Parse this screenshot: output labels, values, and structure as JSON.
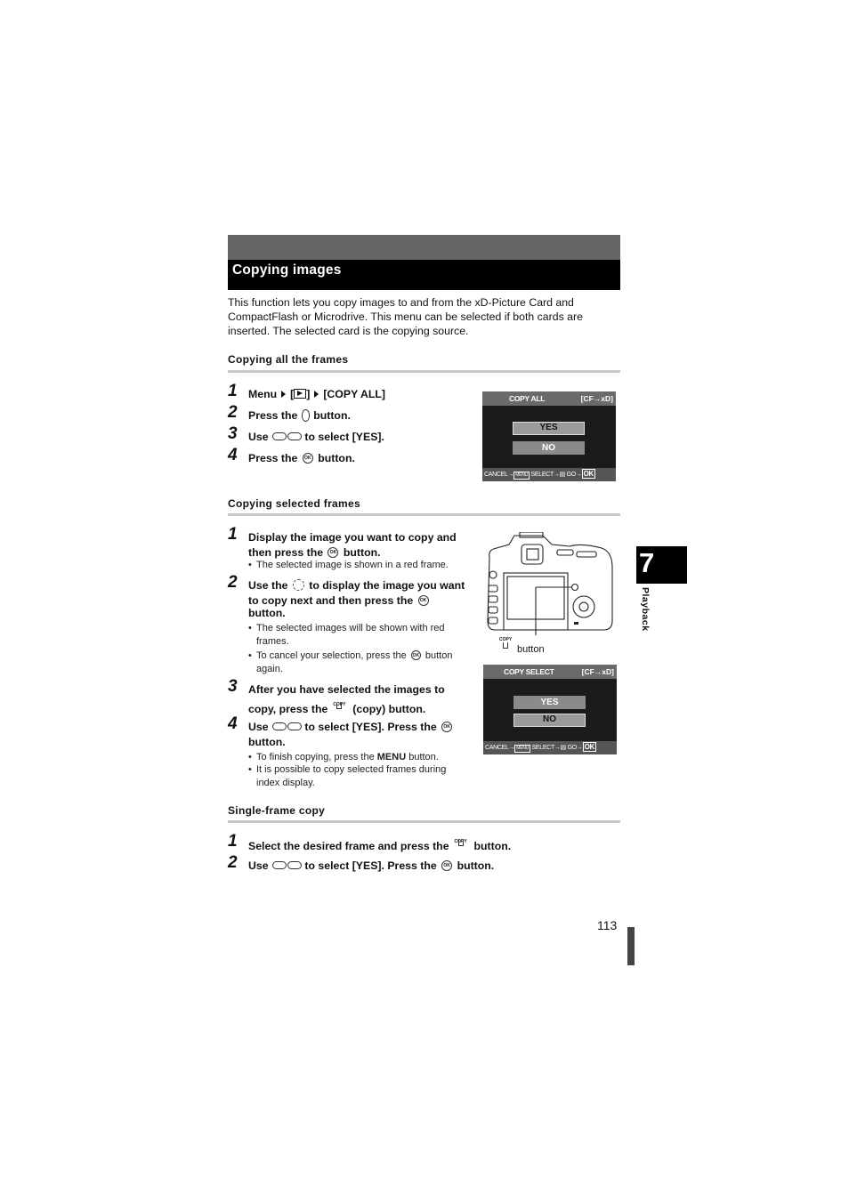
{
  "section_title": "Copying images",
  "intro": "This function lets you copy images to and from the xD-Picture Card and CompactFlash or Microdrive. This menu can be selected if both cards are inserted. The selected card is the copying source.",
  "copy_all": {
    "heading": "Copying all the frames",
    "steps": [
      {
        "num": "1",
        "parts": [
          "Menu",
          "[",
          "]",
          "[COPY ALL]"
        ]
      },
      {
        "num": "2",
        "before": "Press the",
        "after": "button."
      },
      {
        "num": "3",
        "before": "Use",
        "after": "to select [YES]."
      },
      {
        "num": "4",
        "before": "Press the",
        "after": "button."
      }
    ],
    "screen": {
      "title": "COPY ALL",
      "card": "[CF→xD]",
      "options": [
        "YES",
        "NO"
      ],
      "selected": "YES",
      "footer": {
        "cancel": "CANCEL→",
        "menu": "MENU",
        "select": "SELECT→",
        "go": "GO→",
        "ok": "OK"
      }
    }
  },
  "copy_selected": {
    "heading": "Copying selected frames",
    "steps": [
      {
        "num": "1",
        "line1": "Display the image you want to copy and",
        "before": "then press the",
        "after": "button.",
        "bullets": [
          "The selected image is shown in a red frame."
        ]
      },
      {
        "num": "2",
        "before": "Use the",
        "mid": "to display the image you want",
        "line2": "to copy next and then press the",
        "line3": "button.",
        "bullets": [
          "The selected images will be shown with red frames.",
          "To cancel your selection, press the",
          "button again."
        ]
      },
      {
        "num": "3",
        "line1": "After you have selected the images to",
        "before": "copy, press the",
        "after": "(copy) button."
      },
      {
        "num": "4",
        "before": "Use",
        "after": "to select [YES]. Press the",
        "line2": "button.",
        "bullets": [
          "To finish copying, press the",
          "MENU",
          "button.",
          "It is possible to copy selected frames during index display."
        ]
      }
    ],
    "camera_caption": "button",
    "screen": {
      "title": "COPY SELECT",
      "card": "[CF→xD]",
      "options": [
        "YES",
        "NO"
      ],
      "selected": "NO",
      "footer": {
        "cancel": "CANCEL→",
        "menu": "MENU",
        "select": "SELECT→",
        "go": "GO→",
        "ok": "OK"
      }
    }
  },
  "single_frame": {
    "heading": "Single-frame copy",
    "steps": [
      {
        "num": "1",
        "before": "Select the desired frame and press the",
        "after": "button."
      },
      {
        "num": "2",
        "before": "Use",
        "after": "to select [YES].  Press the",
        "end": "button."
      }
    ]
  },
  "icons": {
    "ok": "OK",
    "copy": "COPY",
    "bullet": "•"
  },
  "chapter": {
    "number": "7",
    "label": "Playback"
  },
  "page_number": "113"
}
